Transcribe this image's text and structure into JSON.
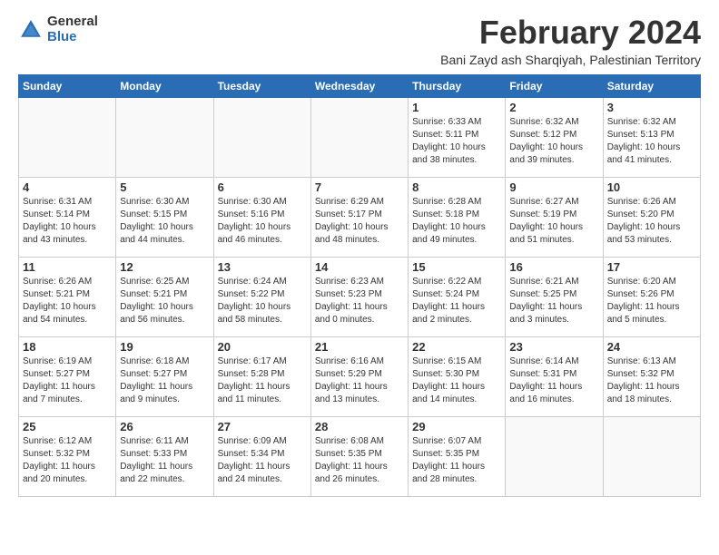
{
  "logo": {
    "general": "General",
    "blue": "Blue"
  },
  "header": {
    "month_year": "February 2024",
    "location": "Bani Zayd ash Sharqiyah, Palestinian Territory"
  },
  "weekdays": [
    "Sunday",
    "Monday",
    "Tuesday",
    "Wednesday",
    "Thursday",
    "Friday",
    "Saturday"
  ],
  "weeks": [
    [
      {
        "day": "",
        "info": ""
      },
      {
        "day": "",
        "info": ""
      },
      {
        "day": "",
        "info": ""
      },
      {
        "day": "",
        "info": ""
      },
      {
        "day": "1",
        "info": "Sunrise: 6:33 AM\nSunset: 5:11 PM\nDaylight: 10 hours\nand 38 minutes."
      },
      {
        "day": "2",
        "info": "Sunrise: 6:32 AM\nSunset: 5:12 PM\nDaylight: 10 hours\nand 39 minutes."
      },
      {
        "day": "3",
        "info": "Sunrise: 6:32 AM\nSunset: 5:13 PM\nDaylight: 10 hours\nand 41 minutes."
      }
    ],
    [
      {
        "day": "4",
        "info": "Sunrise: 6:31 AM\nSunset: 5:14 PM\nDaylight: 10 hours\nand 43 minutes."
      },
      {
        "day": "5",
        "info": "Sunrise: 6:30 AM\nSunset: 5:15 PM\nDaylight: 10 hours\nand 44 minutes."
      },
      {
        "day": "6",
        "info": "Sunrise: 6:30 AM\nSunset: 5:16 PM\nDaylight: 10 hours\nand 46 minutes."
      },
      {
        "day": "7",
        "info": "Sunrise: 6:29 AM\nSunset: 5:17 PM\nDaylight: 10 hours\nand 48 minutes."
      },
      {
        "day": "8",
        "info": "Sunrise: 6:28 AM\nSunset: 5:18 PM\nDaylight: 10 hours\nand 49 minutes."
      },
      {
        "day": "9",
        "info": "Sunrise: 6:27 AM\nSunset: 5:19 PM\nDaylight: 10 hours\nand 51 minutes."
      },
      {
        "day": "10",
        "info": "Sunrise: 6:26 AM\nSunset: 5:20 PM\nDaylight: 10 hours\nand 53 minutes."
      }
    ],
    [
      {
        "day": "11",
        "info": "Sunrise: 6:26 AM\nSunset: 5:21 PM\nDaylight: 10 hours\nand 54 minutes."
      },
      {
        "day": "12",
        "info": "Sunrise: 6:25 AM\nSunset: 5:21 PM\nDaylight: 10 hours\nand 56 minutes."
      },
      {
        "day": "13",
        "info": "Sunrise: 6:24 AM\nSunset: 5:22 PM\nDaylight: 10 hours\nand 58 minutes."
      },
      {
        "day": "14",
        "info": "Sunrise: 6:23 AM\nSunset: 5:23 PM\nDaylight: 11 hours\nand 0 minutes."
      },
      {
        "day": "15",
        "info": "Sunrise: 6:22 AM\nSunset: 5:24 PM\nDaylight: 11 hours\nand 2 minutes."
      },
      {
        "day": "16",
        "info": "Sunrise: 6:21 AM\nSunset: 5:25 PM\nDaylight: 11 hours\nand 3 minutes."
      },
      {
        "day": "17",
        "info": "Sunrise: 6:20 AM\nSunset: 5:26 PM\nDaylight: 11 hours\nand 5 minutes."
      }
    ],
    [
      {
        "day": "18",
        "info": "Sunrise: 6:19 AM\nSunset: 5:27 PM\nDaylight: 11 hours\nand 7 minutes."
      },
      {
        "day": "19",
        "info": "Sunrise: 6:18 AM\nSunset: 5:27 PM\nDaylight: 11 hours\nand 9 minutes."
      },
      {
        "day": "20",
        "info": "Sunrise: 6:17 AM\nSunset: 5:28 PM\nDaylight: 11 hours\nand 11 minutes."
      },
      {
        "day": "21",
        "info": "Sunrise: 6:16 AM\nSunset: 5:29 PM\nDaylight: 11 hours\nand 13 minutes."
      },
      {
        "day": "22",
        "info": "Sunrise: 6:15 AM\nSunset: 5:30 PM\nDaylight: 11 hours\nand 14 minutes."
      },
      {
        "day": "23",
        "info": "Sunrise: 6:14 AM\nSunset: 5:31 PM\nDaylight: 11 hours\nand 16 minutes."
      },
      {
        "day": "24",
        "info": "Sunrise: 6:13 AM\nSunset: 5:32 PM\nDaylight: 11 hours\nand 18 minutes."
      }
    ],
    [
      {
        "day": "25",
        "info": "Sunrise: 6:12 AM\nSunset: 5:32 PM\nDaylight: 11 hours\nand 20 minutes."
      },
      {
        "day": "26",
        "info": "Sunrise: 6:11 AM\nSunset: 5:33 PM\nDaylight: 11 hours\nand 22 minutes."
      },
      {
        "day": "27",
        "info": "Sunrise: 6:09 AM\nSunset: 5:34 PM\nDaylight: 11 hours\nand 24 minutes."
      },
      {
        "day": "28",
        "info": "Sunrise: 6:08 AM\nSunset: 5:35 PM\nDaylight: 11 hours\nand 26 minutes."
      },
      {
        "day": "29",
        "info": "Sunrise: 6:07 AM\nSunset: 5:35 PM\nDaylight: 11 hours\nand 28 minutes."
      },
      {
        "day": "",
        "info": ""
      },
      {
        "day": "",
        "info": ""
      }
    ]
  ]
}
